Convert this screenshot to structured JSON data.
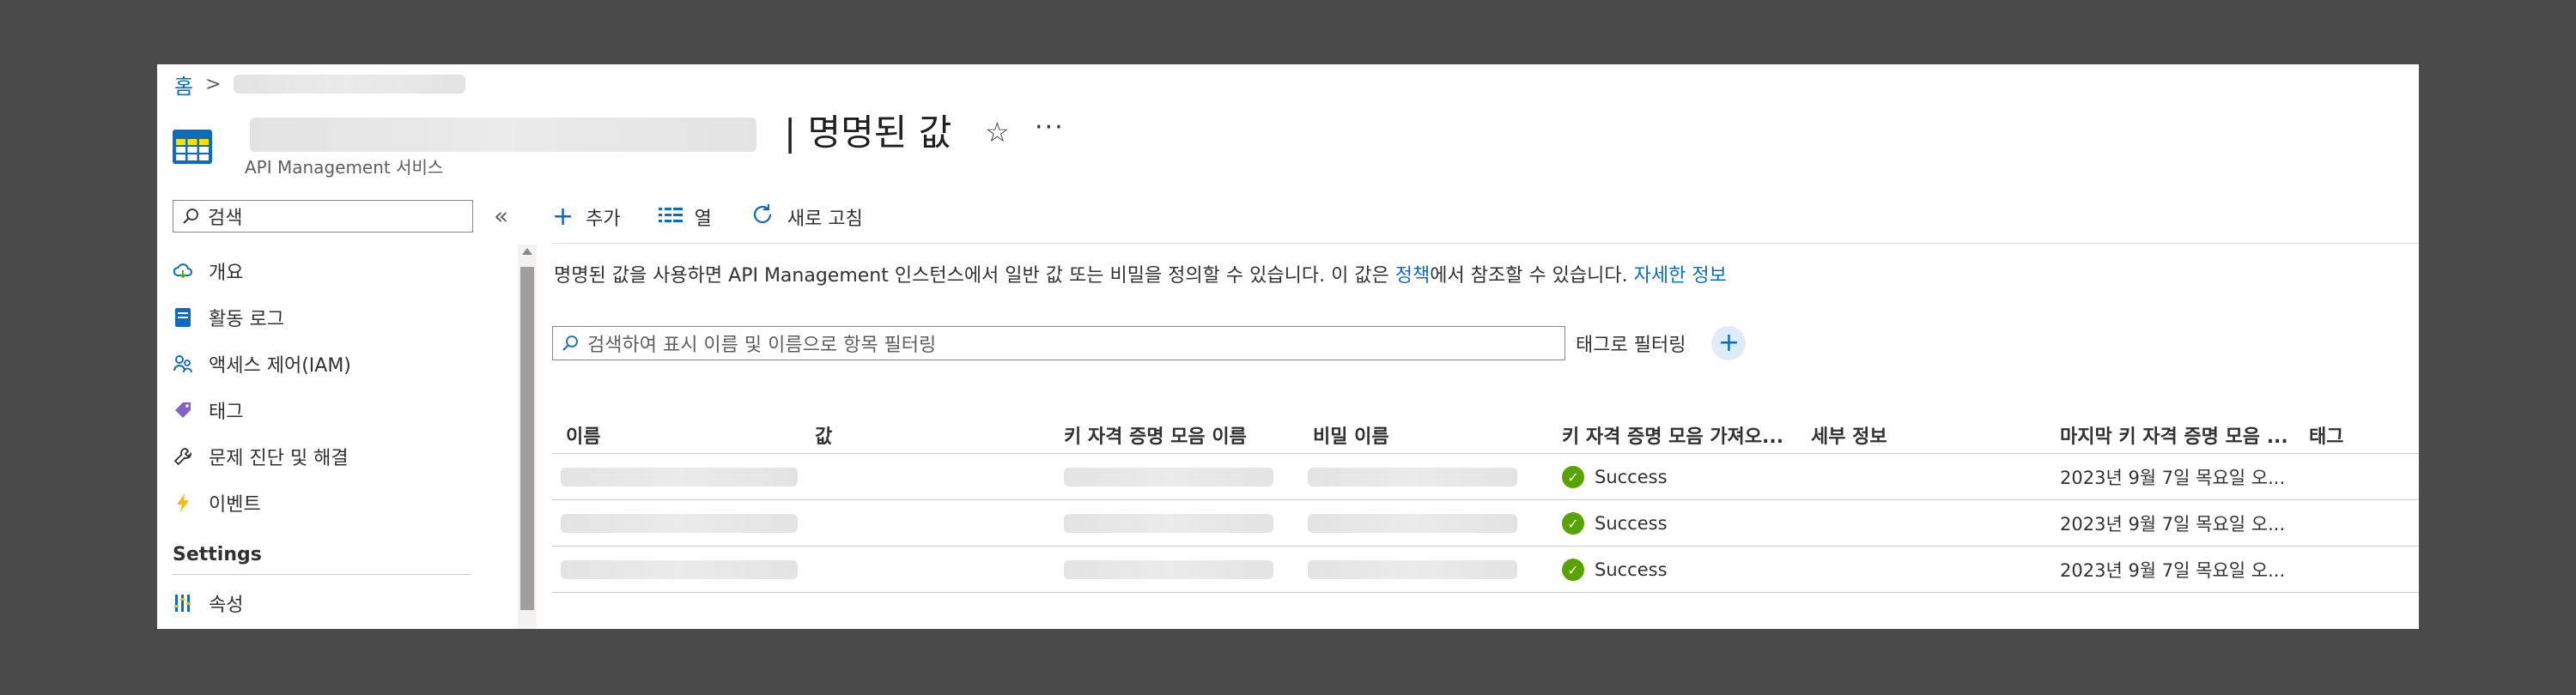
{
  "breadcrumb": {
    "home": "홈",
    "separator": ">"
  },
  "header": {
    "title": "| 명명된 값",
    "subtitle": "API Management 서비스",
    "favorite_icon": "star-icon",
    "more_icon": "more-icon"
  },
  "sidebar": {
    "search_placeholder": "검색",
    "collapse_label": "«",
    "items": [
      {
        "label": "개요",
        "icon": "cloud-icon"
      },
      {
        "label": "활동 로그",
        "icon": "log-icon"
      },
      {
        "label": "액세스 제어(IAM)",
        "icon": "people-icon"
      },
      {
        "label": "태그",
        "icon": "tag-icon"
      },
      {
        "label": "문제 진단 및 해결",
        "icon": "wrench-icon"
      },
      {
        "label": "이벤트",
        "icon": "lightning-icon"
      }
    ],
    "section_settings": "Settings",
    "settings_items": [
      {
        "label": "속성",
        "icon": "properties-icon"
      }
    ]
  },
  "toolbar": {
    "add_label": "추가",
    "columns_label": "열",
    "refresh_label": "새로 고침"
  },
  "description": {
    "part1": "명명된 값을 사용하면 API Management 인스턴스에서 일반 값 또는 비밀을 정의할 수 있습니다. 이 값은 ",
    "policy_link": "정책",
    "part2": "에서 참조할 수 있습니다. ",
    "learn_more_link": "자세한 정보"
  },
  "filter": {
    "placeholder": "검색하여 표시 이름 및 이름으로 항목 필터링",
    "tag_filter_label": "태그로 필터링",
    "add_tag_label": "+"
  },
  "table": {
    "columns": [
      "이름",
      "값",
      "키 자격 증명 모음 이름",
      "비밀 이름",
      "키 자격 증명 모음 가져오...",
      "세부 정보",
      "마지막 키 자격 증명 모음 ...",
      "태그"
    ],
    "rows": [
      {
        "status": "Success",
        "last_refresh": "2023년 9월 7일 목요일 오..."
      },
      {
        "status": "Success",
        "last_refresh": "2023년 9월 7일 목요일 오..."
      },
      {
        "status": "Success",
        "last_refresh": "2023년 9월 7일 목요일 오..."
      }
    ]
  },
  "colors": {
    "accent": "#0f6cbd",
    "success": "#57a300",
    "background": "#4a4a4a"
  }
}
